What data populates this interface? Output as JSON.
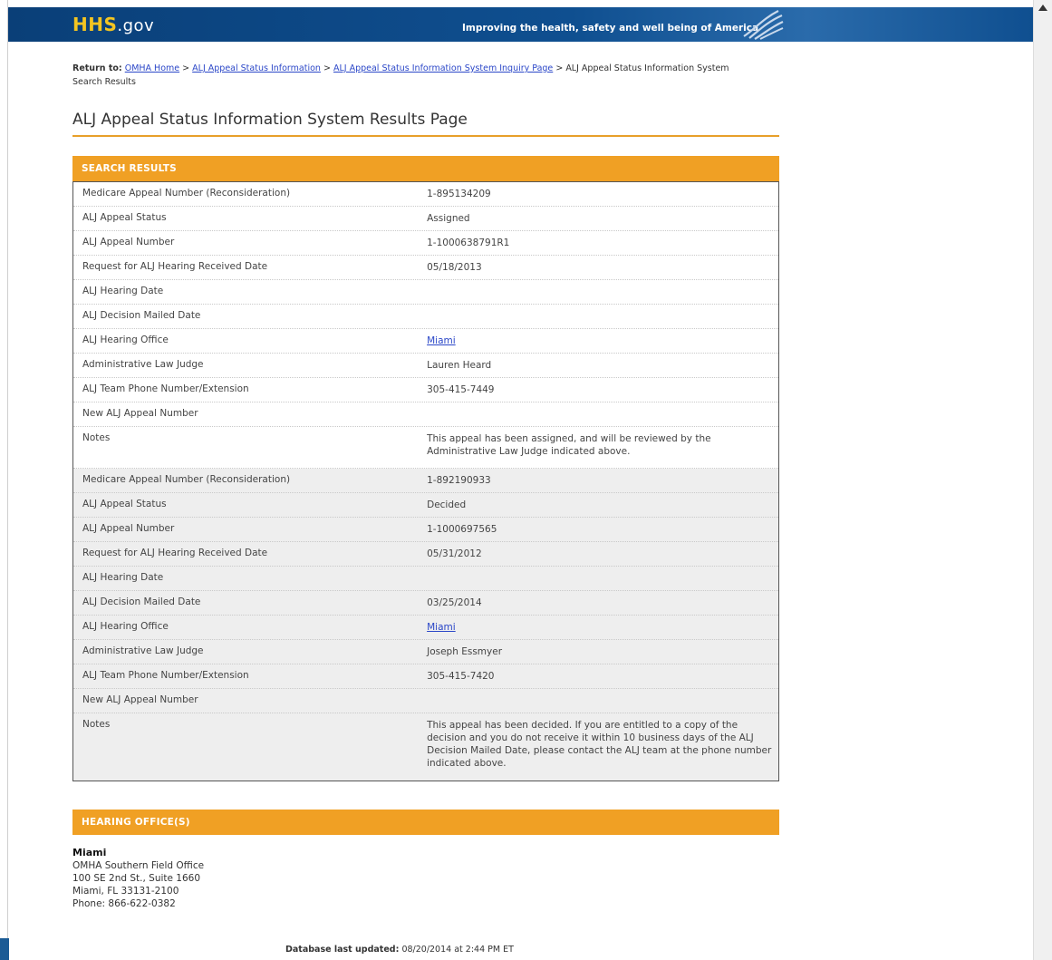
{
  "header": {
    "logo_main": "HHS",
    "logo_suffix": ".gov",
    "tagline": "Improving the health, safety and well being of America"
  },
  "breadcrumb": {
    "lead": "Return to:",
    "links": [
      "OMHA Home",
      "ALJ Appeal Status Information",
      "ALJ Appeal Status Information System Inquiry Page"
    ],
    "separator": ">",
    "current": "ALJ Appeal Status Information System Search Results"
  },
  "page_title": "ALJ Appeal Status Information System Results Page",
  "results": {
    "header": "SEARCH RESULTS",
    "appeals": [
      {
        "rows": [
          {
            "label": "Medicare Appeal Number (Reconsideration)",
            "value": "1-895134209"
          },
          {
            "label": "ALJ Appeal Status",
            "value": "Assigned"
          },
          {
            "label": "ALJ Appeal Number",
            "value": "1-1000638791R1"
          },
          {
            "label": "Request for ALJ Hearing Received Date",
            "value": "05/18/2013"
          },
          {
            "label": "ALJ Hearing Date",
            "value": ""
          },
          {
            "label": "ALJ Decision Mailed Date",
            "value": ""
          },
          {
            "label": "ALJ Hearing Office",
            "value": "Miami"
          },
          {
            "label": "Administrative Law Judge",
            "value": "Lauren Heard"
          },
          {
            "label": "ALJ Team Phone Number/Extension",
            "value": "305-415-7449"
          },
          {
            "label": "New ALJ Appeal Number",
            "value": ""
          },
          {
            "label": "Notes",
            "value": "This appeal has been assigned, and will be reviewed by the Administrative Law Judge indicated above."
          }
        ]
      },
      {
        "rows": [
          {
            "label": "Medicare Appeal Number (Reconsideration)",
            "value": "1-892190933"
          },
          {
            "label": "ALJ Appeal Status",
            "value": "Decided"
          },
          {
            "label": "ALJ Appeal Number",
            "value": "1-1000697565"
          },
          {
            "label": "Request for ALJ Hearing Received Date",
            "value": "05/31/2012"
          },
          {
            "label": "ALJ Hearing Date",
            "value": ""
          },
          {
            "label": "ALJ Decision Mailed Date",
            "value": "03/25/2014"
          },
          {
            "label": "ALJ Hearing Office",
            "value": "Miami"
          },
          {
            "label": "Administrative Law Judge",
            "value": "Joseph Essmyer"
          },
          {
            "label": "ALJ Team Phone Number/Extension",
            "value": "305-415-7420"
          },
          {
            "label": "New ALJ Appeal Number",
            "value": ""
          },
          {
            "label": "Notes",
            "value": "This appeal has been decided. If you are entitled to a copy of the decision and you do not receive it within 10 business days of the ALJ Decision Mailed Date, please contact the ALJ team at the phone number indicated above."
          }
        ]
      }
    ]
  },
  "hearing_offices": {
    "header": "HEARING OFFICE(S)",
    "name": "Miami",
    "line1": "OMHA Southern Field Office",
    "line2": "100 SE 2nd St., Suite 1660",
    "line3": "Miami, FL 33131-2100",
    "line4": "Phone: 866-622-0382"
  },
  "footer": {
    "label": "Database last updated:",
    "value": "08/20/2014 at 2:44 PM ET"
  },
  "colors": {
    "banner": "#0f4f90",
    "logo": "#f3c521",
    "section_header": "#f0a024",
    "link": "#2b47c8"
  }
}
